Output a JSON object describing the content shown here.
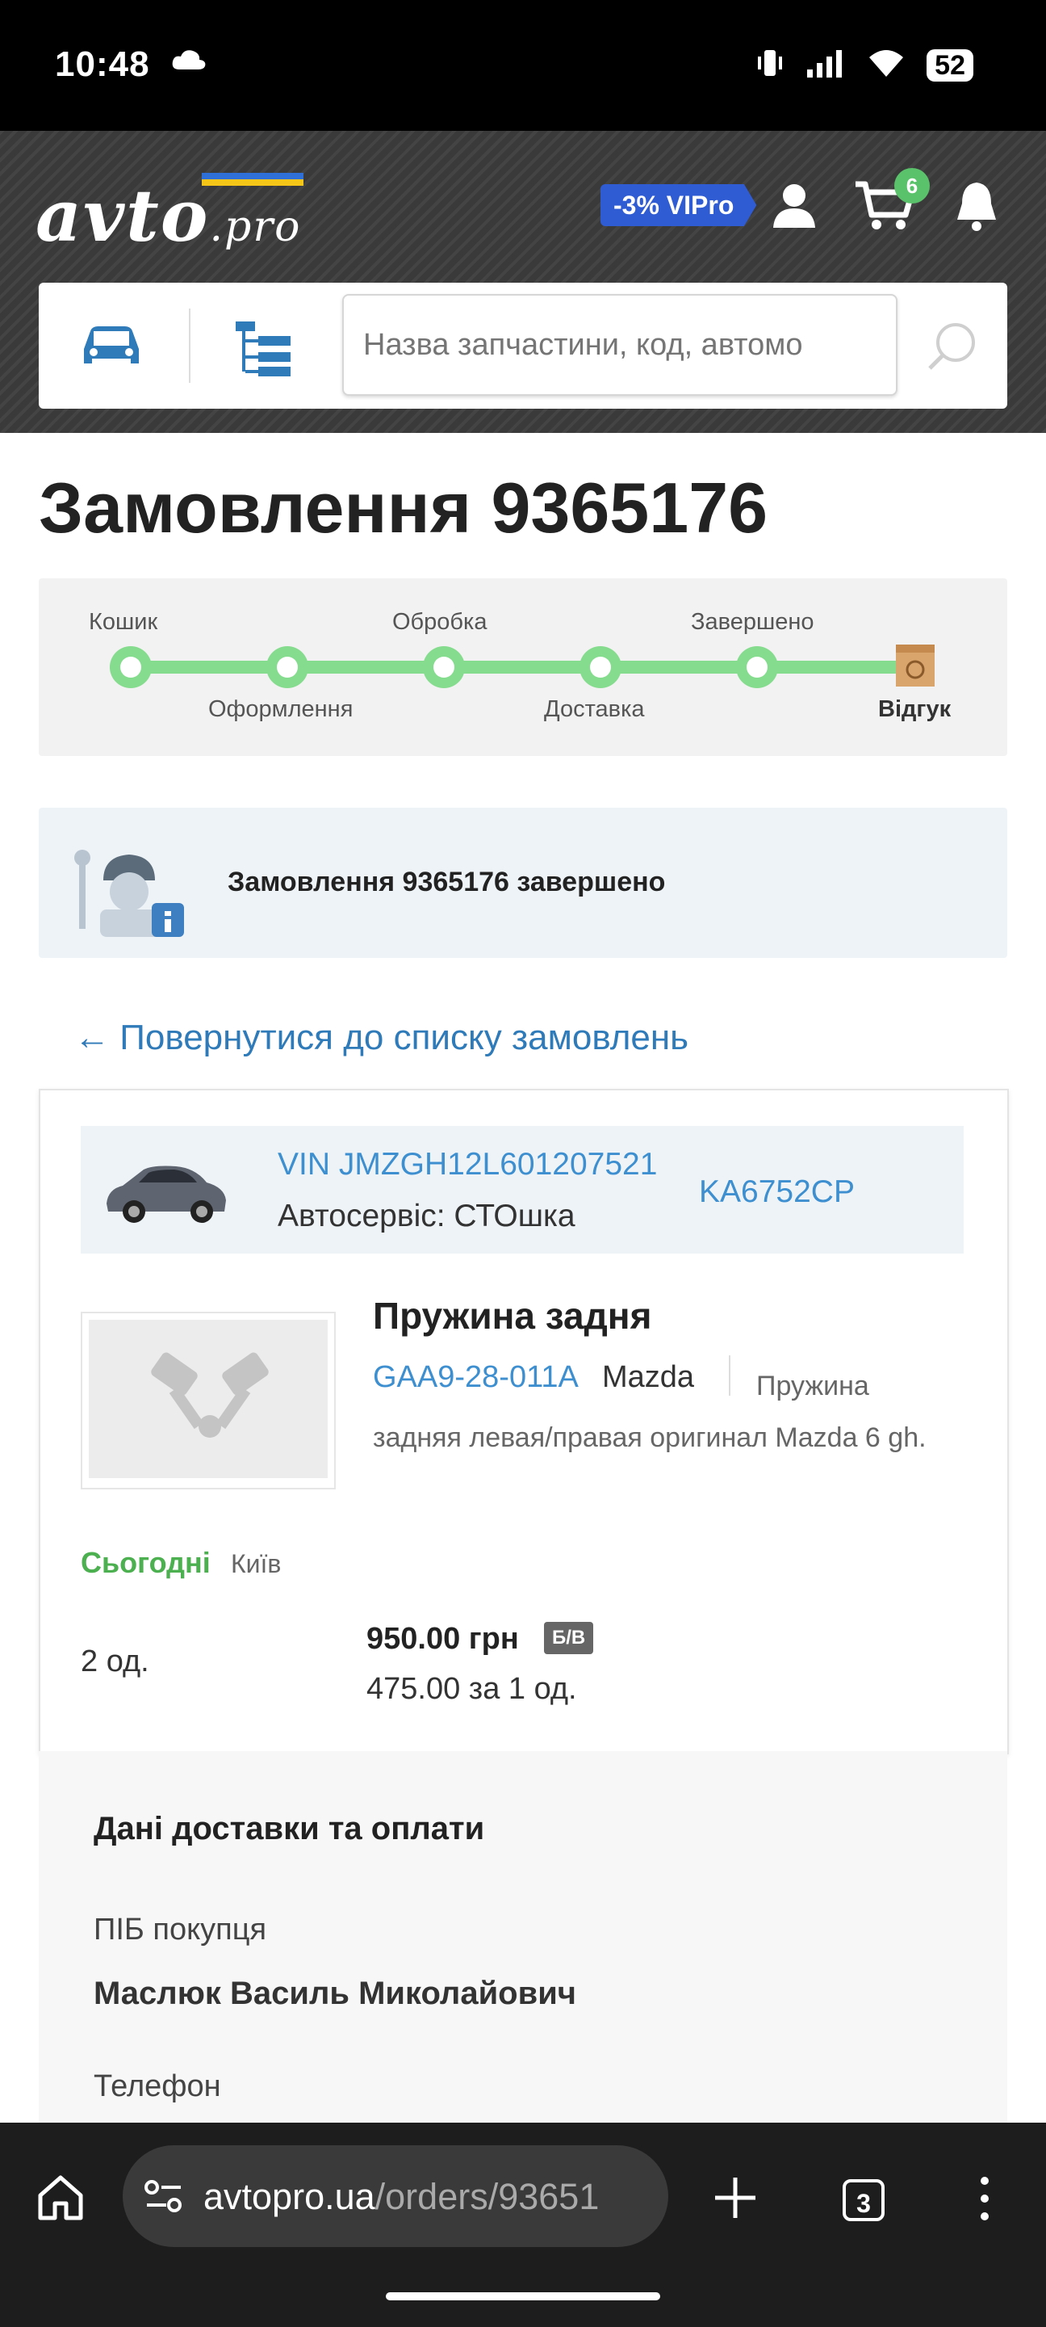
{
  "status_bar": {
    "time": "10:48",
    "battery": "52"
  },
  "header": {
    "logo_main": "avto",
    "logo_pro": ".pro",
    "vip_badge": "-3%  VIPro",
    "cart_count": "6",
    "search_placeholder": "Назва запчастини, код, автомо",
    "colors": {
      "background": "#3a3a3a",
      "accent": "#2f5bd3",
      "badge": "#5ac26b"
    }
  },
  "page": {
    "title": "Замовлення 9365176",
    "progress": {
      "steps": [
        "Кошик",
        "Оформлення",
        "Обробка",
        "Доставка",
        "Завершено",
        "Відгук"
      ],
      "color": "#86dc8e"
    },
    "banner_text": "Замовлення 9365176 завершено",
    "back_link": "← Повернутися до списку замовлень"
  },
  "order": {
    "vehicle": {
      "vin": "VIN JMZGH12L601207521",
      "service": "Автосервіс: СТОшка",
      "plate": "KA6752CP"
    },
    "product": {
      "name": "Пружина задня",
      "code": "GAA9-28-011A",
      "brand": "Mazda",
      "description": "Пружина задняя левая/правая оригинал Mazda 6 gh."
    },
    "availability": "Сьогодні",
    "city": "Київ",
    "quantity": "2 од.",
    "total_price": "950.00 грн",
    "condition": "Б/В",
    "unit_price": "475.00 за 1 од."
  },
  "delivery": {
    "title": "Дані доставки та оплати",
    "buyer_label": "ПІБ покупця",
    "buyer_name": "Маслюк Василь Миколайович",
    "phone_label": "Телефон"
  },
  "browser": {
    "url_host": "avtopro.ua",
    "url_path": "/orders/93651",
    "tab_count": "3"
  }
}
